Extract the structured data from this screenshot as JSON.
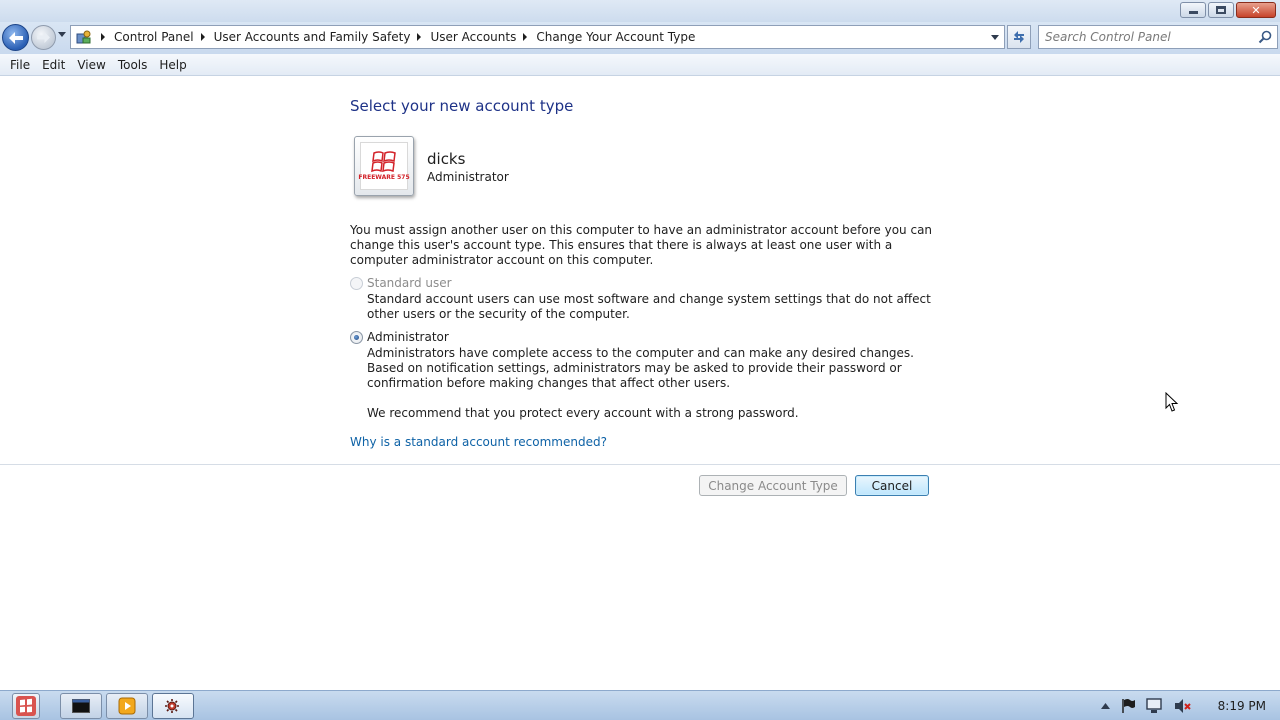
{
  "window": {
    "minimize_icon": "minimize-icon",
    "maximize_icon": "restore-icon",
    "close_icon": "close-icon"
  },
  "addressbar": {
    "breadcrumbs": [
      "Control Panel",
      "User Accounts and Family Safety",
      "User Accounts",
      "Change Your Account Type"
    ],
    "search_placeholder": "Search Control Panel"
  },
  "menu": [
    "File",
    "Edit",
    "View",
    "Tools",
    "Help"
  ],
  "main": {
    "heading": "Select your new account type",
    "user": {
      "name": "dicks",
      "role": "Administrator",
      "tile_text": "FREEWARE 575"
    },
    "warning": "You must assign another user on this computer to have an administrator account before you can change this user's account type. This ensures that there is always at least one user with a computer administrator account on this computer.",
    "options": [
      {
        "label": "Standard user",
        "description": "Standard account users can use most software and change system settings that do not affect other users or the security of the computer.",
        "selected": false,
        "enabled": false
      },
      {
        "label": "Administrator",
        "description": "Administrators have complete access to the computer and can make any desired changes. Based on notification settings, administrators may be asked to provide their password or confirmation before making changes that affect other users.",
        "selected": true,
        "enabled": true
      }
    ],
    "recommendation": "We recommend that you protect every account with a strong password.",
    "help_link": "Why is a standard account recommended?",
    "buttons": {
      "change": "Change Account Type",
      "cancel": "Cancel"
    }
  },
  "taskbar": {
    "clock": "8:19 PM"
  },
  "colors": {
    "heading": "#1e3287",
    "link": "#0e62a6",
    "taskbar": "#b8cee8"
  }
}
